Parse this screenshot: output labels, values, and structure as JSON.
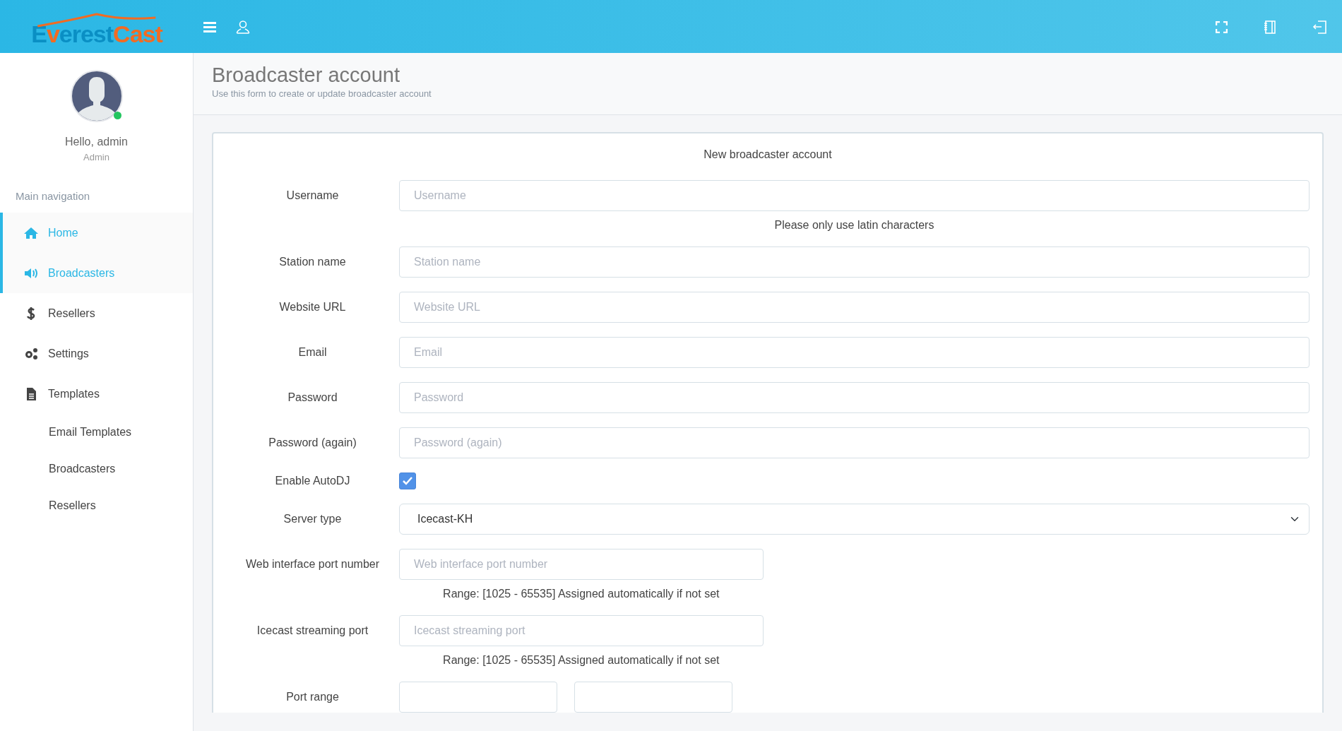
{
  "logo": {
    "parts": [
      {
        "text": "E",
        "kind": "blue"
      },
      {
        "text": "v",
        "kind": "orange"
      },
      {
        "text": "erest",
        "kind": "blue"
      },
      {
        "text": "Cast",
        "kind": "orange"
      }
    ]
  },
  "user": {
    "greeting": "Hello, admin",
    "role": "Admin",
    "online": true
  },
  "sidebar": {
    "heading": "Main navigation",
    "items": [
      {
        "label": "Home",
        "selected": true
      },
      {
        "label": "Broadcasters",
        "selected": true
      },
      {
        "label": "Resellers",
        "selected": false
      },
      {
        "label": "Settings",
        "selected": false
      },
      {
        "label": "Templates",
        "selected": false,
        "children": [
          {
            "label": "Email Templates",
            "selected": false
          },
          {
            "label": "Broadcasters",
            "selected": false
          },
          {
            "label": "Resellers",
            "selected": false
          }
        ]
      }
    ]
  },
  "page": {
    "title": "Broadcaster account",
    "subtitle": "Use this form to create or update broadcaster account"
  },
  "form": {
    "title": "New broadcaster account",
    "fields": [
      {
        "kind": "text",
        "label": "Username",
        "placeholder": "Username",
        "help": "Please only use latin characters"
      },
      {
        "kind": "text",
        "label": "Station name",
        "placeholder": "Station name"
      },
      {
        "kind": "text",
        "label": "Website URL",
        "placeholder": "Website URL"
      },
      {
        "kind": "text",
        "label": "Email",
        "placeholder": "Email"
      },
      {
        "kind": "text",
        "label": "Password",
        "placeholder": "Password"
      },
      {
        "kind": "text",
        "label": "Password (again)",
        "placeholder": "Password (again)"
      },
      {
        "kind": "checkbox",
        "label": "Enable AutoDJ",
        "checked": true
      },
      {
        "kind": "select",
        "label": "Server type",
        "value": "Icecast-KH"
      },
      {
        "kind": "half",
        "label": "Web interface port number",
        "placeholder": "Web interface port number",
        "help": "Range: [1025 - 65535] Assigned automatically if not set"
      },
      {
        "kind": "half",
        "label": "Icecast streaming port",
        "placeholder": "Icecast streaming port",
        "help": "Range: [1025 - 65535] Assigned automatically if not set"
      },
      {
        "kind": "range",
        "label": "Port range"
      }
    ]
  }
}
